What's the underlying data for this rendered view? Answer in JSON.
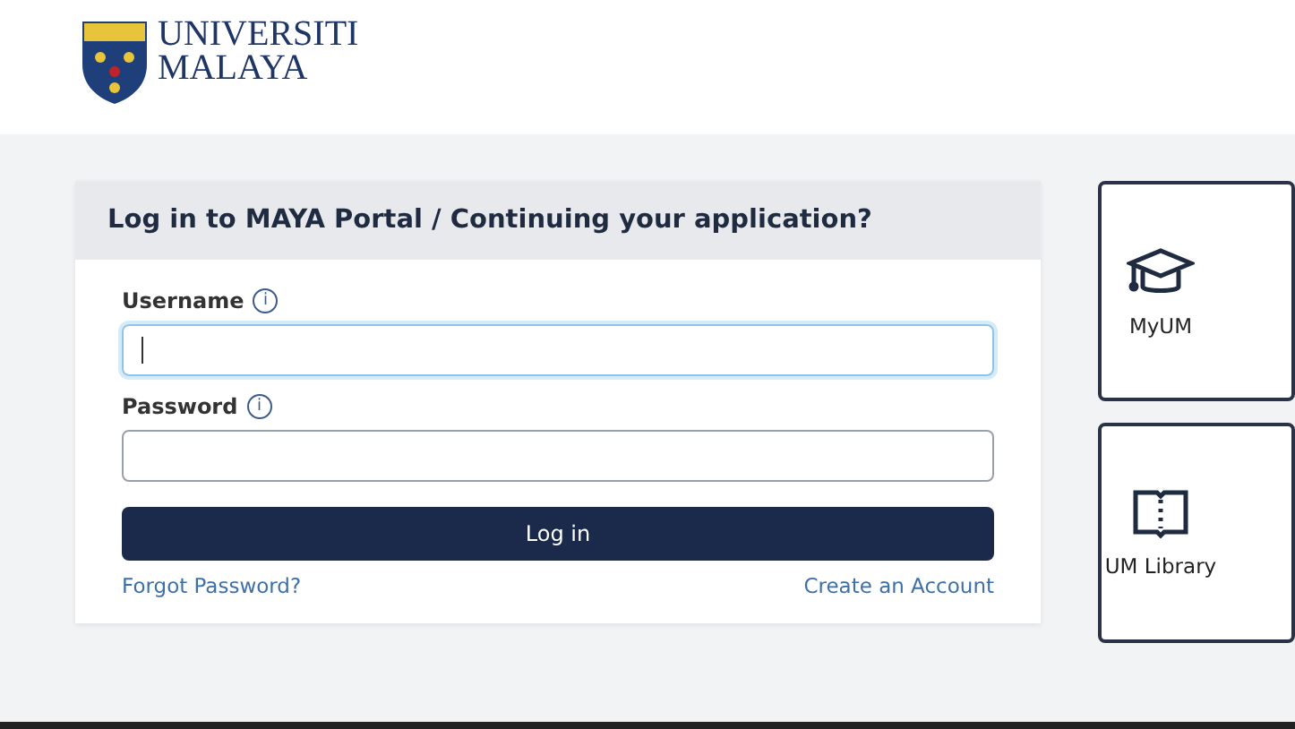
{
  "logo": {
    "line1": "UNIVERSITI",
    "line2": "MALAYA"
  },
  "login": {
    "title": "Log in to MAYA Portal / Continuing your application?",
    "fields": [
      {
        "label": "Username",
        "info": "i",
        "focused": true
      },
      {
        "label": "Password",
        "info": "i",
        "focused": false
      }
    ],
    "submit": "Log in",
    "links": [
      "Forgot Password?",
      "Create an Account"
    ]
  },
  "tiles": [
    {
      "label": "MyUM",
      "kind": "cap"
    },
    {
      "label": "UM Library",
      "kind": "book"
    }
  ]
}
